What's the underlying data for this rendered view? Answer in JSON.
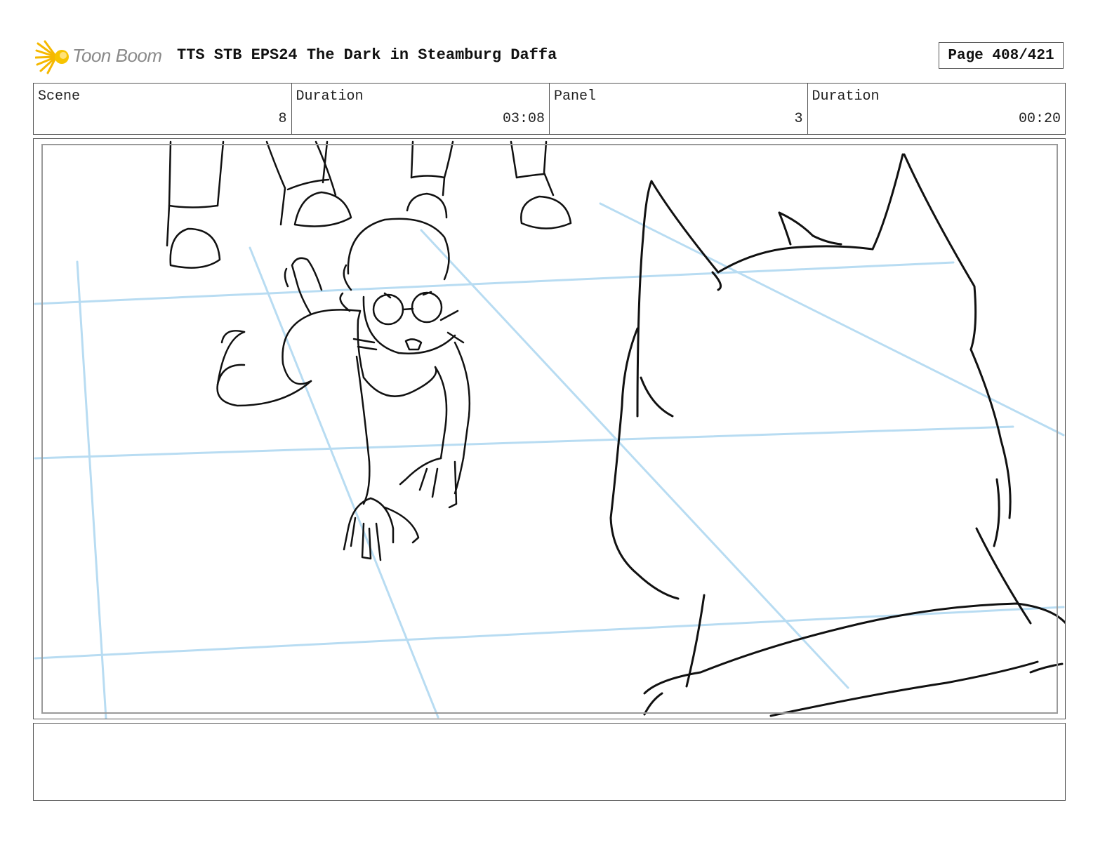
{
  "header": {
    "logo_text": "Toon Boom",
    "title": "TTS STB EPS24 The Dark in Steamburg Daffa",
    "page": "Page 408/421"
  },
  "info": {
    "scene_label": "Scene",
    "scene_value": "8",
    "scene_duration_label": "Duration",
    "scene_duration_value": "03:08",
    "panel_label": "Panel",
    "panel_value": "3",
    "panel_duration_label": "Duration",
    "panel_duration_value": "00:20"
  },
  "panel": {
    "guide_color": "#b8dcf2",
    "line_color": "#111111"
  },
  "notes": {
    "text": ""
  }
}
